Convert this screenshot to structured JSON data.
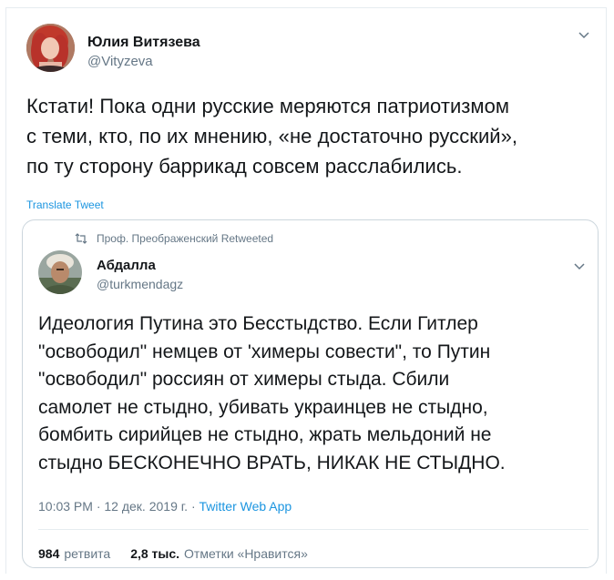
{
  "tweet": {
    "author_name": "Юлия Витязева",
    "author_handle": "@Vityzeva",
    "text_lines": [
      "Кстати! Пока одни русские меряются патриотизмом",
      "с теми, кто, по их мнению, «не достаточно русский»,",
      "по ту сторону баррикад совсем расслабились."
    ],
    "translate_label": "Translate Tweet"
  },
  "quoted": {
    "retweeted_by": "Проф. Преображенский Retweeted",
    "author_name": "Абдалла",
    "author_handle": "@turkmendagz",
    "text_lines": [
      "Идеология Путина это Бесстыдство. Если Гитлер",
      "\"освободил\" немцев от 'химеры совести\", то Путин",
      "\"освободил\" россиян от химеры стыда. Сбили",
      "самолет не стыдно,  убивать украинцев не стыдно,",
      "бомбить сирийцев не стыдно, жрать мельдоний не",
      "стыдно БЕСКОНЕЧНО  ВРАТЬ,  НИКАК НЕ СТЫДНО."
    ],
    "time": "10:03 PM",
    "date": "12 дек. 2019 г.",
    "separator": "·",
    "source": "Twitter Web App",
    "retweet_count": "984",
    "retweet_label": "ретвита",
    "like_count": "2,8 тыс.",
    "like_label": "Отметки «Нравится»"
  },
  "icons": {
    "chevron": "chevron-down-icon",
    "retweet": "retweet-icon"
  },
  "colors": {
    "text": "#14171a",
    "muted": "#657786",
    "link": "#1b95e0",
    "border": "#ccd6dd"
  }
}
